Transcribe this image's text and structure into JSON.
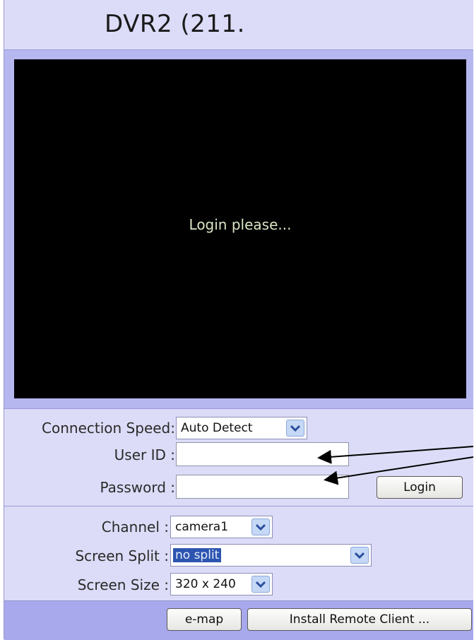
{
  "title": "DVR2 (211.",
  "video": {
    "message": "Login please..."
  },
  "login": {
    "connection_speed_label": "Connection Speed:",
    "connection_speed_value": "Auto Detect",
    "user_id_label": "User ID :",
    "user_id_value": "",
    "password_label": "Password :",
    "password_value": "",
    "login_button": "Login"
  },
  "view": {
    "channel_label": "Channel :",
    "channel_value": "camera1",
    "screen_split_label": "Screen Split :",
    "screen_split_value": "no split",
    "screen_size_label": "Screen Size :",
    "screen_size_value": "320 x 240"
  },
  "footer": {
    "emap_button": "e-map",
    "install_button": "Install Remote Client ..."
  },
  "colors": {
    "panel": "#dcdcf8",
    "video_border": "#b7b7f0",
    "selection": "#2d55b0"
  },
  "icons": [
    "chevron-down-icon",
    "annotation-arrow-icon"
  ]
}
